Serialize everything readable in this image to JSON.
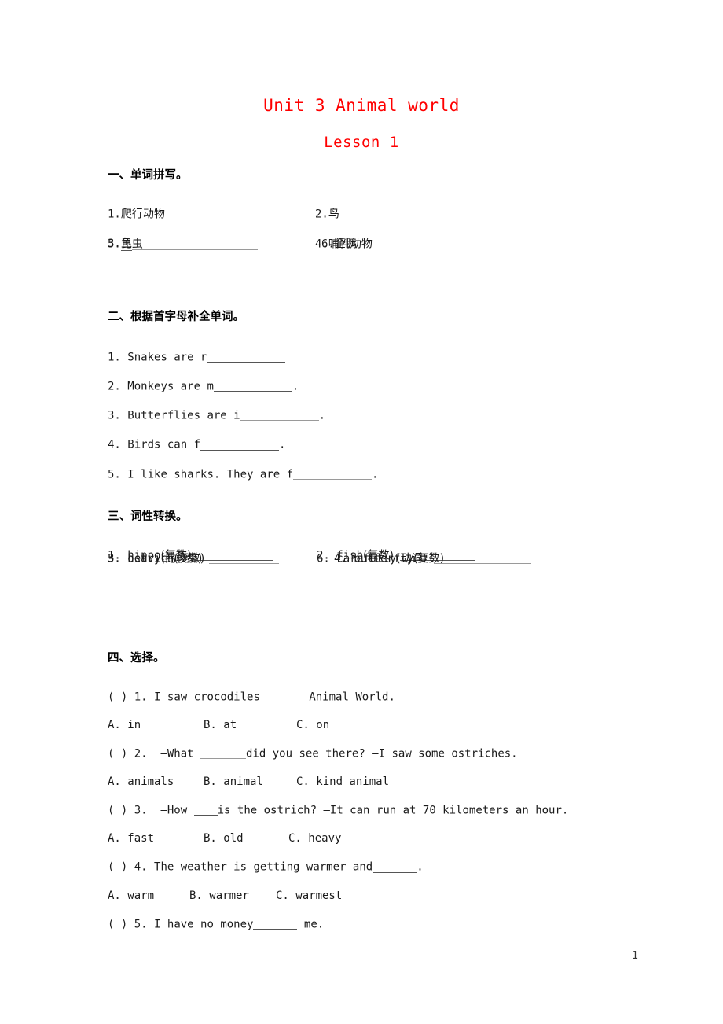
{
  "title": {
    "main": "Unit 3 Animal world",
    "sub": "Lesson 1",
    "color": "#ff0000"
  },
  "page_number": "1",
  "sections": [
    {
      "heading": "一、单词拼写。",
      "type": "spelling-two-column",
      "items": [
        {
          "num": "1.",
          "label": "爬行动物",
          "label_underlined": false
        },
        {
          "num": "2.",
          "label": "鸟",
          "label_underlined": false
        },
        {
          "num": "3.",
          "label": "鱼",
          "label_underlined": true
        },
        {
          "num": "4.",
          "label": "哺乳动物",
          "label_underlined": false
        },
        {
          "num": "5.",
          "label": "昆虫",
          "label_underlined": false
        },
        {
          "num": "6.",
          "label": "企鹅",
          "label_underlined": false
        }
      ]
    },
    {
      "heading": "二、根据首字母补全单词。",
      "type": "fill-initial",
      "items": [
        {
          "num": "1.",
          "pre": "Snakes are r",
          "post": ""
        },
        {
          "num": "2.",
          "pre": "Monkeys are m",
          "post": "."
        },
        {
          "num": "3.",
          "pre": "Butterflies are i",
          "post": "."
        },
        {
          "num": "4.",
          "pre": "Birds can f",
          "post": "."
        },
        {
          "num": "5.",
          "pre": "I like sharks. They are f",
          "post": "."
        }
      ]
    },
    {
      "heading": "三、词性转换。",
      "type": "word-form-two-column",
      "items": [
        {
          "num": "1.",
          "word": "hippo",
          "form": "(复数)"
        },
        {
          "num": "2.",
          "word": "fish",
          "form": "(复数)"
        },
        {
          "num": "3.",
          "word": "ostrich",
          "form": "(复数)"
        },
        {
          "num": "4.",
          "word": "butterfly",
          "form": "(复数)"
        },
        {
          "num": "5.",
          "word": "heavy",
          "form": "(比较级)"
        },
        {
          "num": "6.",
          "word": "carefully",
          "form": "(动词)"
        }
      ]
    },
    {
      "heading": "四、选择。",
      "type": "multiple-choice",
      "questions": [
        {
          "bracket": "(  )",
          "num": "1.",
          "pre": "I saw crocodiles ",
          "post": "Animal World.",
          "options": [
            "A. in",
            "B. at",
            "C. on"
          ]
        },
        {
          "bracket": "(  )",
          "num": "2.",
          "pre": "–What ",
          "post": "did you see there? –I saw some ostriches.",
          "options": [
            "A. animals",
            "B. animal",
            "C. kind animal"
          ]
        },
        {
          "bracket": "(  )",
          "num": "3.",
          "pre": "–How ",
          "post": "is the ostrich? –It can run at 70 kilometers an hour.",
          "options": [
            "A. fast",
            "B. old",
            "C. heavy"
          ]
        },
        {
          "bracket": "(  )",
          "num": "4.",
          "pre": "The weather is getting warmer and",
          "post": ".",
          "options": [
            "A. warm",
            "B. warmer",
            "C. warmest"
          ]
        },
        {
          "bracket": "(  )",
          "num": "5.",
          "pre": "I have no money",
          "post": " me.",
          "options": []
        }
      ]
    }
  ]
}
